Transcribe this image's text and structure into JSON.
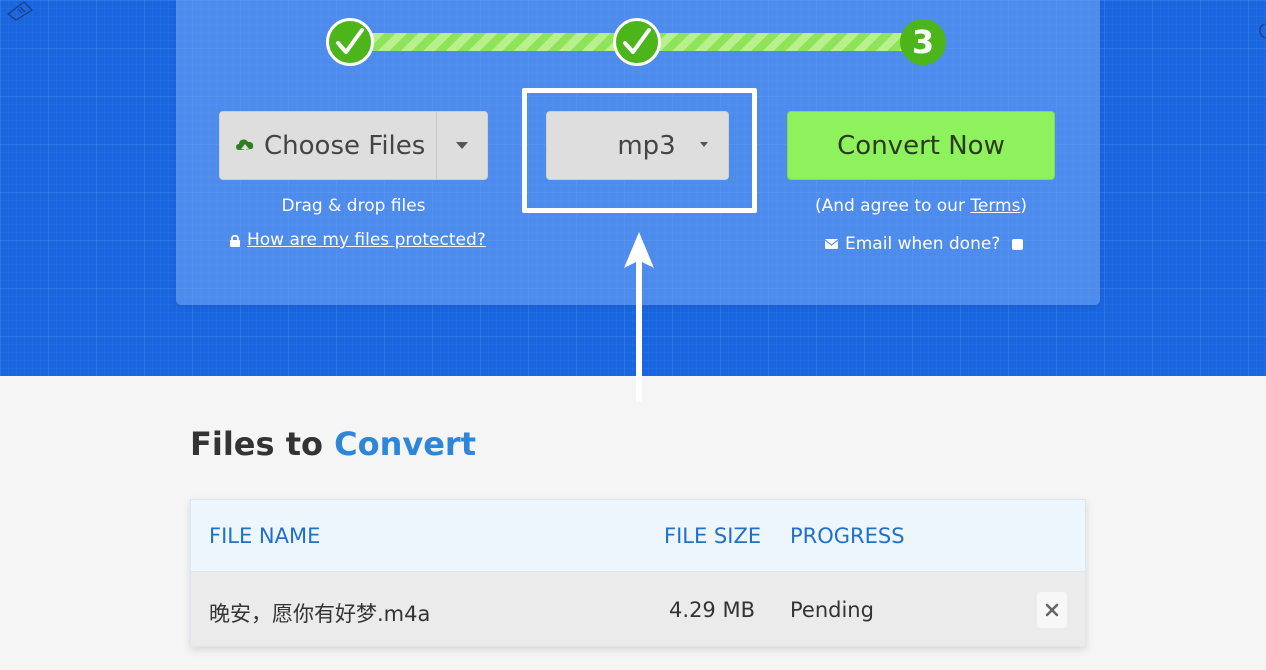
{
  "steps": {
    "step3_number": "3"
  },
  "upload": {
    "choose_label": "Choose Files",
    "drag_text": "Drag & drop files",
    "protect_link": "How are my files protected?"
  },
  "format": {
    "selected": "mp3"
  },
  "convert": {
    "button_label": "Convert Now",
    "terms_prefix": "(And agree to our ",
    "terms_link": "Terms",
    "terms_suffix": ")",
    "email_label": "Email when done?"
  },
  "files": {
    "title_part1": "Files to ",
    "title_part2": "Convert",
    "columns": {
      "name": "FILE NAME",
      "size": "FILE SIZE",
      "progress": "PROGRESS"
    },
    "rows": [
      {
        "name": "晚安，愿你有好梦.m4a",
        "size": "4.29 MB",
        "progress": "Pending"
      }
    ]
  },
  "colors": {
    "hero_blue": "#1a66e0",
    "step_green": "#4bb51a",
    "convert_green": "#8ef25c",
    "accent_blue": "#2e86d8",
    "header_blue": "#1e70c8"
  },
  "icons": [
    "upload-cloud-icon",
    "chevron-down-icon",
    "lock-icon",
    "check-icon",
    "envelope-icon",
    "close-icon"
  ]
}
